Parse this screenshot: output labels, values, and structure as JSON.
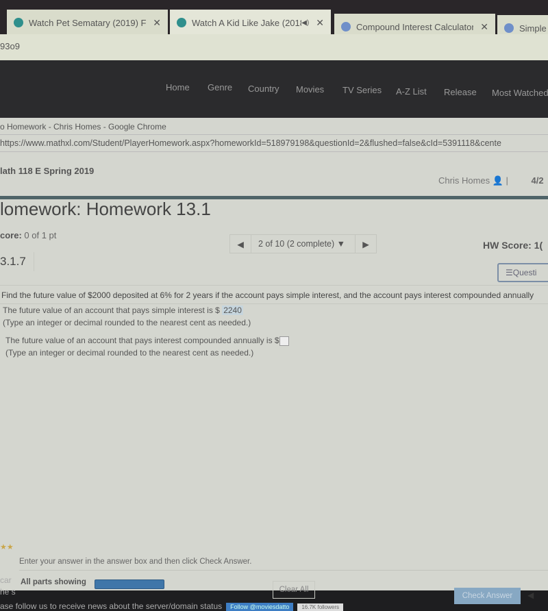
{
  "browser_tabs": [
    {
      "title": "Watch Pet Sematary (2019) Full",
      "icon": "play-icon"
    },
    {
      "title": "Watch A Kid Like Jake (2018",
      "icon": "play-icon",
      "muted": true
    },
    {
      "title": "Compound Interest Calculator",
      "icon": "globe-icon"
    },
    {
      "title": "Simple",
      "icon": "globe-icon"
    }
  ],
  "address_fragment": "93o9",
  "site_nav": [
    "Home",
    "Genre",
    "Country",
    "Movies",
    "TV Series",
    "A-Z List",
    "Release",
    "Most Watched"
  ],
  "window": {
    "title": "o Homework - Chris Homes - Google Chrome",
    "url": "https://www.mathxl.com/Student/PlayerHomework.aspx?homeworkId=518979198&questionId=2&flushed=false&cId=5391118&cente"
  },
  "course": "lath 118 E Spring 2019",
  "user": {
    "name": "Chris Homes",
    "date": "4/2"
  },
  "homework_title": "lomework: Homework 13.1",
  "score": {
    "label": "core:",
    "value": "0 of 1 pt"
  },
  "pager": {
    "text": "2 of 10 (2 complete)"
  },
  "hw_score": "HW Score: 1(",
  "question_number": "3.1.7",
  "question_menu": "Questi",
  "prompt": "Find the future value of $2000 deposited at 6% for 2 years if the account pays simple interest, and the account pays interest compounded annually",
  "part1": {
    "text": "The future value of an account that pays simple interest is $",
    "answer": "2240",
    "hint": "(Type an integer or decimal rounded to the nearest cent as needed.)"
  },
  "part2": {
    "text": "The future value of an account that pays interest compounded annually is $",
    "answer": "",
    "hint": "(Type an integer or decimal rounded to the nearest cent as needed.)"
  },
  "footer": {
    "instructions": "Enter your answer in the answer box and then click Check Answer.",
    "parts": "All parts showing",
    "progress_percent": 100,
    "clear": "Clear All",
    "check": "Check Answer"
  },
  "background_page": {
    "side1": "car",
    "side2": "he s",
    "follow": "ase follow us to receive news about the server/domain status",
    "twitter": "Follow @moviesdatto",
    "followers": "16.7K followers"
  }
}
